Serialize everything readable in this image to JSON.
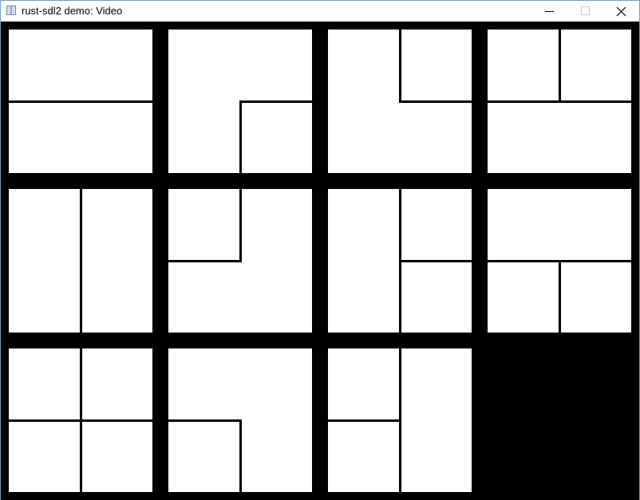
{
  "window": {
    "title": "rust-sdl2 demo: Video",
    "icon": "app-window-icon",
    "controls": {
      "minimize_icon": "minimize-icon",
      "maximize_icon": "maximize-icon",
      "close_icon": "close-icon"
    }
  },
  "canvas": {
    "background": "#000000",
    "tile_color": "#ffffff",
    "line_color": "#000000",
    "grid_columns": 4,
    "grid_rows": 3,
    "tile_count": 11,
    "tiles": [
      {
        "row": 1,
        "col": 1,
        "pattern": "horizontal-split"
      },
      {
        "row": 1,
        "col": 2,
        "pattern": "bottom-right-quadrant"
      },
      {
        "row": 1,
        "col": 3,
        "pattern": "top-right-quadrant"
      },
      {
        "row": 1,
        "col": 4,
        "pattern": "two-top-quadrants"
      },
      {
        "row": 2,
        "col": 1,
        "pattern": "vertical-split"
      },
      {
        "row": 2,
        "col": 2,
        "pattern": "top-left-quadrant"
      },
      {
        "row": 2,
        "col": 3,
        "pattern": "two-right-quadrants"
      },
      {
        "row": 2,
        "col": 4,
        "pattern": "two-bottom-quadrants"
      },
      {
        "row": 3,
        "col": 1,
        "pattern": "four-quadrants"
      },
      {
        "row": 3,
        "col": 2,
        "pattern": "bottom-left-quadrant"
      },
      {
        "row": 3,
        "col": 3,
        "pattern": "two-left-quadrants"
      }
    ]
  }
}
